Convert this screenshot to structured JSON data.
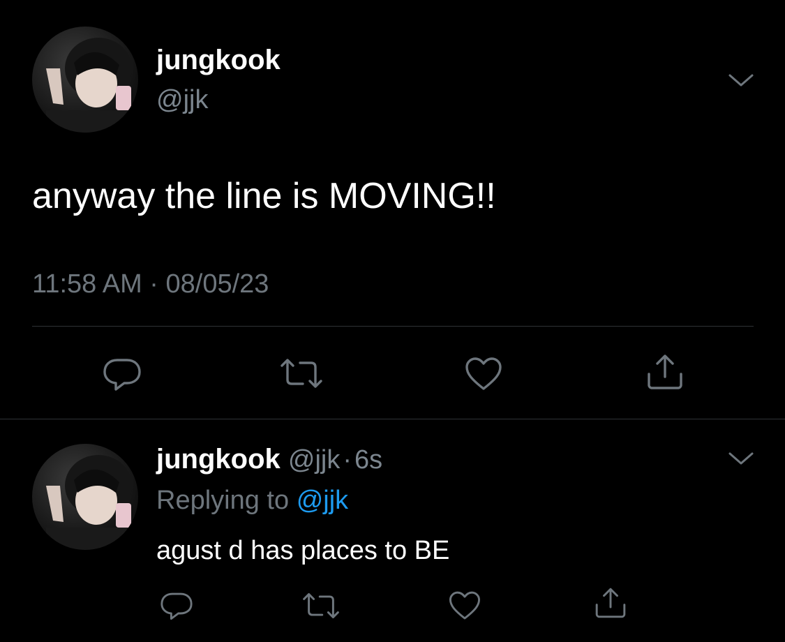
{
  "main_tweet": {
    "author_name": "jungkook",
    "author_handle": "@jjk",
    "text": "anyway the line is MOVING!!",
    "timestamp": "11:58 AM · 08/05/23",
    "actions": [
      "reply-icon",
      "retweet-icon",
      "like-icon",
      "share-icon"
    ]
  },
  "reply_tweet": {
    "author_name": "jungkook",
    "author_handle": "@jjk",
    "separator": "·",
    "time_ago": "6s",
    "replying_prefix": "Replying to",
    "replying_handle": "@jjk",
    "text": "agust d has places to BE",
    "actions": [
      "reply-icon",
      "retweet-icon",
      "like-icon",
      "share-icon"
    ]
  },
  "colors": {
    "background": "#000000",
    "muted": "#6e767d",
    "link": "#1d9bf0",
    "divider": "#2f3336"
  }
}
